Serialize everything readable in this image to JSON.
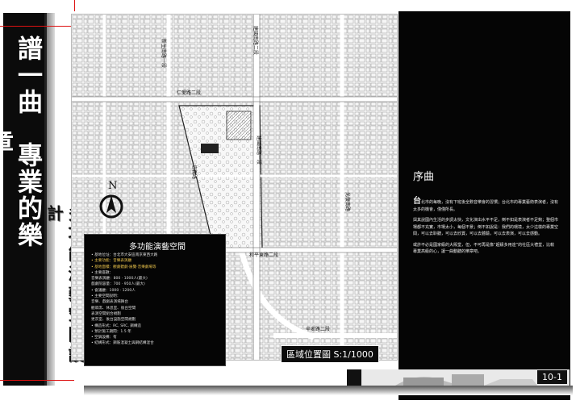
{
  "title_vertical": "譜一曲　專業的樂章",
  "subtitle_vertical": "多功能演藝空間設計",
  "preface": {
    "title": "序曲",
    "lead_char": "台",
    "p1_rest": "北市的每晚，沒有下班後全數音樂會的習慣；台北市的專業藝術表演者，沒有太多的機會，僅僅所長。",
    "p2": "與其說國內生活的步調太快，文化演出水平不足，倒不如是表演者不足夠；整個市場都不充實，市場太小，每個不景；倒不如說是：我們的環境，太少這樣的專業空間，可以去聆聽，可以去欣賞，可以去體驗，可以去表演，可以去感動。",
    "p3": "或許不必是國家級的大殿堂，但，不可再是像“超級多用途”的社區大禮堂，比較專業高級的心，讓一曲動聽的樂章吧。"
  },
  "info_box": {
    "title": "多功能演藝空間",
    "items": [
      "• 基地位址：台北市大安區南京東西大路",
      "• 主要功能：音樂表演廳",
      "• 基地面積：觀劇聽劇·展覽·音樂劇場等",
      "• 主要座數：",
      "  音樂表演廳：800 · 1000人(最大)",
      "  戲劇院容量：700 · 950人(最大)",
      "• 會議廳：1000 · 1200人",
      "• 主要空間說明：",
      "  音樂、戲劇表演場舞台",
      "  觀眾席、休息室、後台空間",
      "  表演空間組合規劃",
      "  更衣室、後台設施空間規劃",
      "• 構造形式：RC, SRC, 鋼構造",
      "• 預計施工期間：1.5 年",
      "• 空調設備：有",
      "• 結構形式：鋼筋混凝土與鋼結構混合"
    ]
  },
  "map": {
    "caption": "區域位置圖 S:1/1000",
    "road_labels": [
      "新生南路一段",
      "建國南路二段",
      "建國南路一段",
      "仁愛路二段",
      "信義路",
      "和平東路二段",
      "辛亥路二段",
      "光復南路"
    ],
    "compass_letter": "N"
  },
  "page_number": "10-1",
  "colors": {
    "accent_red": "#d11111",
    "panel_black": "#050505",
    "info_highlight": "#e8c14a"
  }
}
